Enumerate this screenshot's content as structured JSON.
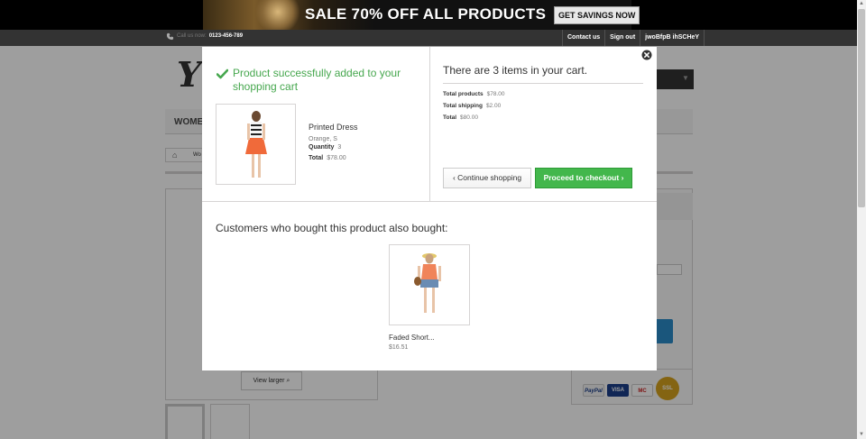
{
  "promo": {
    "text": "SALE 70% OFF ALL PRODUCTS",
    "button": "GET SAVINGS NOW"
  },
  "header": {
    "phone_label": "Call us now:",
    "phone_number": "0123-456-789",
    "links": [
      "Contact us",
      "Sign out",
      "jwoBfpB ihSCHeY"
    ]
  },
  "page_bg": {
    "logo_letter": "Y",
    "menu_women": "WOMEN",
    "breadcrumb": "Wo",
    "view_larger": "View larger"
  },
  "modal": {
    "success_message": "Product successfully added to your shopping cart",
    "product": {
      "name": "Printed Dress",
      "attributes": "Orange, S",
      "quantity_label": "Quantity",
      "quantity": "3",
      "total_label": "Total",
      "total": "$78.00"
    },
    "cart": {
      "count_text": "There are 3 items in your cart.",
      "total_products_label": "Total products",
      "total_products": "$78.00",
      "total_shipping_label": "Total shipping",
      "total_shipping": "$2.00",
      "total_label": "Total",
      "total": "$80.00"
    },
    "continue_label": "Continue shopping",
    "checkout_label": "Proceed to checkout",
    "also_bought_title": "Customers who bought this product also bought:",
    "recommended": {
      "name": "Faded Short...",
      "price": "$16.51"
    }
  },
  "payments": [
    "PayPal",
    "VISA",
    "MC",
    "SSL"
  ],
  "colors": {
    "success_green": "#46a74e",
    "checkout_green": "#43b74c",
    "header_bg": "#333333"
  }
}
